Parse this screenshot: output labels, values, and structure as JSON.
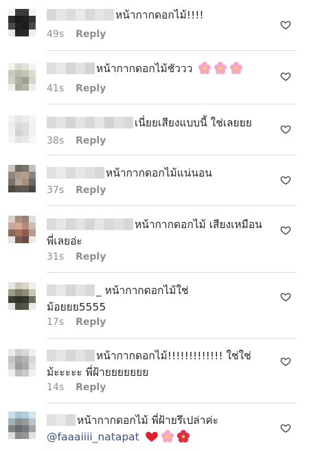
{
  "comments": [
    {
      "text": "หน้ากากดอกไม้!!!!",
      "time": "49s",
      "reply": "Reply"
    },
    {
      "text": "หน้ากากดอกไม้ชัววว",
      "time": "41s",
      "reply": "Reply",
      "emoji": [
        "flower",
        "flower",
        "flower"
      ]
    },
    {
      "text": "เนี่ยยเสียงแบบนี้ ใช่เลยยย",
      "time": "38s",
      "reply": "Reply"
    },
    {
      "text": "หน้ากากดอกไม้แน่นอน",
      "time": "37s",
      "reply": "Reply"
    },
    {
      "text": "หน้ากากดอกไม้ เสียงเหมือน",
      "text2": "พี่เลยอ่ะ",
      "time": "31s",
      "reply": "Reply"
    },
    {
      "text": "_ หน้ากากดอกไม้ใช่",
      "text2": "ม้อยยย5555",
      "time": "17s",
      "reply": "Reply"
    },
    {
      "text": "หน้ากากดอกไม้!!!!!!!!!!!!! ใช่ใช่",
      "text2": "ม้ะะะะะ พี่ฝ้ายยยยยยย",
      "time": "14s",
      "reply": "Reply"
    },
    {
      "text": "หน้ากากดอกไม้ พี่ฝ้ายรึเปล่าค่ะ",
      "mention": "@faaaiiii_natapat",
      "time": "",
      "reply": "",
      "emoji": [
        "heart",
        "flower",
        "hibiscus"
      ]
    }
  ],
  "icons": {
    "like": "heart-outline-icon"
  },
  "colors": {
    "meta": "#8e8e8e",
    "mention": "#385185",
    "divider": "#dbdbdb",
    "heart_emoji": "#e0202c",
    "flower_emoji": "#f4a7c6"
  }
}
